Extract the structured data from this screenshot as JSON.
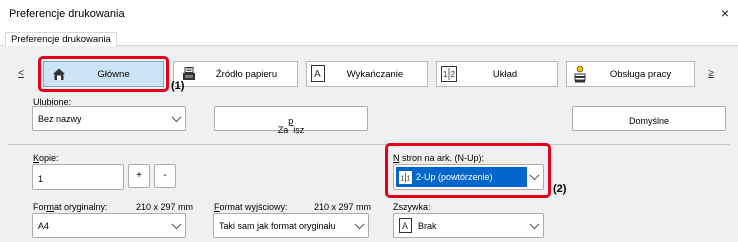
{
  "window": {
    "title": "Preferencje drukowania",
    "close_glyph": "×"
  },
  "tabs": [
    {
      "label": "Preferencje drukowania"
    }
  ],
  "nav": {
    "prev_glyph": "<",
    "next_glyph": "≥",
    "items": [
      {
        "label": "Główne",
        "icon": "home-icon",
        "active": true
      },
      {
        "label": "Źródło papieru",
        "icon": "paper-tray-icon"
      },
      {
        "label": "Wykańczanie",
        "icon": "finishing-icon"
      },
      {
        "label": "Układ",
        "icon": "layout-icon",
        "icon_text": "1|2"
      },
      {
        "label": "Obsługa pracy",
        "icon": "job-handling-icon"
      }
    ]
  },
  "callouts": {
    "one": "(1)",
    "two": "(2)"
  },
  "favorites": {
    "label_u": "U",
    "label_rest": "lubione:",
    "value": "Bez nazwy",
    "save_prefix": "Za",
    "save_u": "p",
    "save_suffix": "isz",
    "defaults_label": "Domyślne"
  },
  "copies": {
    "label_u": "K",
    "label_rest": "opie:",
    "value": "1",
    "plus": "+",
    "minus": "-"
  },
  "nup": {
    "label_u": "N",
    "label_rest": " stron na ark. (N-Up):",
    "value": "2-Up (powtórzenie)",
    "icon_text": "1|1"
  },
  "original_format": {
    "label_prefix": "For",
    "label_u": "m",
    "label_suffix": "at oryginalny:",
    "size": "210 x 297 mm",
    "value": "A4"
  },
  "output_format": {
    "label_u": "F",
    "label_rest": "ormat wyjściowy:",
    "size": "210 x 297 mm",
    "value": "Taki sam jak format oryginału"
  },
  "staple": {
    "label": "Zszywka:",
    "value": "Brak",
    "icon_text": "A"
  },
  "colors": {
    "accent": "#e4001b",
    "selection": "#0066cc",
    "active_nav": "#cce4f7"
  }
}
